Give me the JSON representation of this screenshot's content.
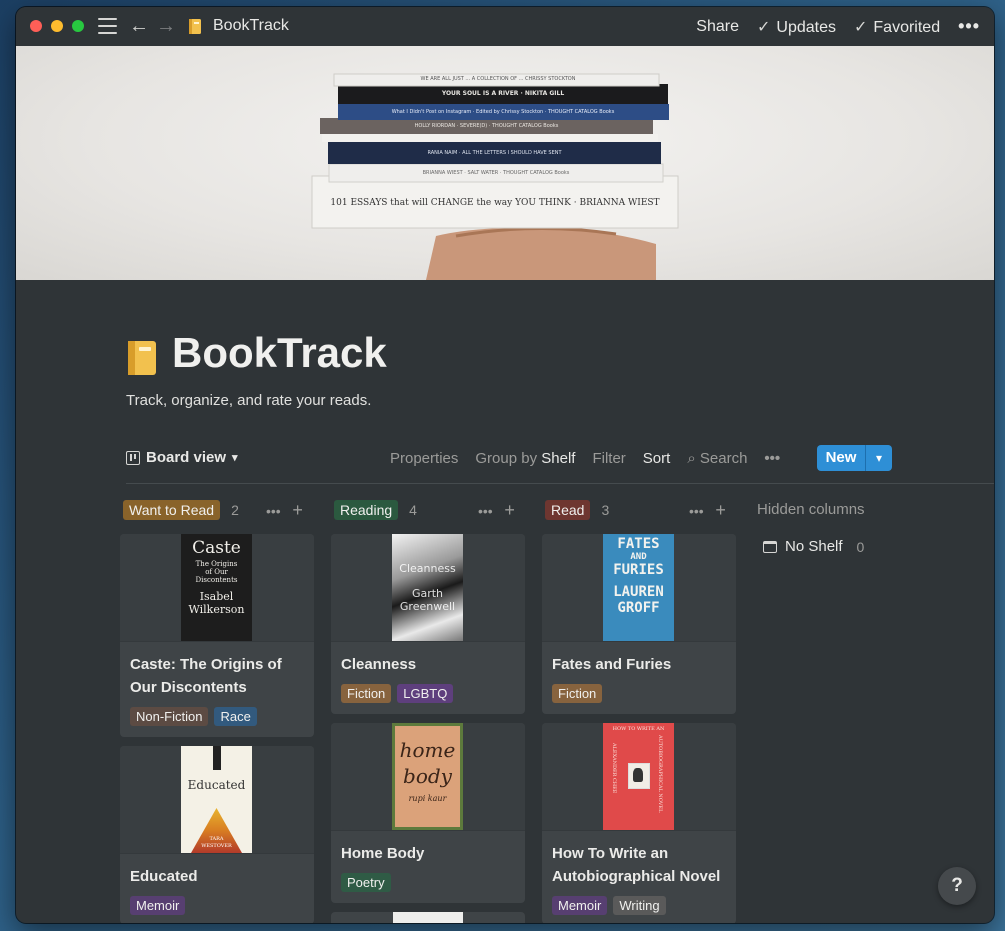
{
  "window": {
    "title": "BookTrack"
  },
  "titlebar": {
    "share": "Share",
    "updates": "Updates",
    "favorited": "Favorited",
    "more": "•••"
  },
  "page": {
    "title": "BookTrack",
    "description": "Track, organize, and rate your reads."
  },
  "toolbar": {
    "view": "Board view",
    "properties": "Properties",
    "group_by_prefix": "Group by",
    "group_by_value": "Shelf",
    "filter": "Filter",
    "sort": "Sort",
    "search": "Search",
    "more": "•••",
    "new": "New"
  },
  "columns": [
    {
      "name": "Want to Read",
      "count": "2",
      "color": "#89632a"
    },
    {
      "name": "Reading",
      "count": "4",
      "color": "#2b593f"
    },
    {
      "name": "Read",
      "count": "3",
      "color": "#6e3630"
    }
  ],
  "hidden_columns": {
    "label": "Hidden columns",
    "no_shelf": "No Shelf",
    "no_shelf_count": "0"
  },
  "cards": [
    {
      "title_lines": [
        "Caste: The Origins of",
        "Our Discontents"
      ],
      "tags": [
        "Non-Fiction",
        "Race"
      ],
      "cover_text": [
        "Caste",
        "The Origins",
        "of Our",
        "Discontents",
        "Isabel",
        "Wilkerson"
      ]
    },
    {
      "title_lines": [
        "Educated"
      ],
      "tags": [
        "Memoir"
      ],
      "cover_text": [
        "Educated",
        "TARA",
        "WESTOVER"
      ]
    },
    {
      "title_lines": [
        "Cleanness"
      ],
      "tags": [
        "Fiction",
        "LGBTQ"
      ],
      "cover_text": [
        "Cleanness",
        "Garth",
        "Greenwell"
      ]
    },
    {
      "title_lines": [
        "Home Body"
      ],
      "tags": [
        "Poetry"
      ],
      "cover_text": [
        "home",
        "body",
        "rupi kaur"
      ]
    },
    {
      "title_lines": [
        "Fates and Furies"
      ],
      "tags": [
        "Fiction"
      ],
      "cover_text": [
        "FATES",
        "AND",
        "FURIES",
        "LAUREN",
        "GROFF"
      ]
    },
    {
      "title_lines": [
        "How To Write an",
        "Autobiographical Novel"
      ],
      "tags": [
        "Memoir",
        "Writing"
      ],
      "cover_text": [
        "HOW TO WRITE AN",
        "AUTOBIOGRAPHICAL NOVEL",
        "ALEXANDER CHEE"
      ]
    }
  ],
  "tag_colors": {
    "Non-Fiction": "#5c4b43",
    "Race": "#325a7e",
    "Memoir": "#573f71",
    "Fiction": "#87633e",
    "LGBTQ": "#5e3f7d",
    "Poetry": "#2f5b45",
    "Writing": "#5a5a5a"
  },
  "cover_books": [
    "WE ARE ALL JUST ... A COLLECTION OF ... CHRISSY STOCKTON",
    "YOUR SOUL IS A RIVER · NIKITA GILL",
    "What I Didn't Post on Instagram · Edited by Chrissy Stockton · THOUGHT CATALOG Books",
    "HOLLY RIORDAN · SEVERE(D) · THOUGHT CATALOG Books",
    "RANIA NAIM · ALL THE LETTERS I SHOULD HAVE SENT",
    "BRIANNA WIEST · SALT WATER · THOUGHT CATALOG Books",
    "101 ESSAYS that will CHANGE the way YOU THINK · BRIANNA WIEST"
  ],
  "help": "?"
}
